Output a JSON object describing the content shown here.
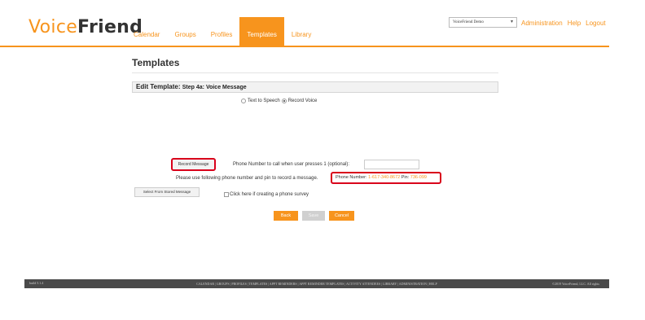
{
  "brand": {
    "part1": "Voice",
    "part2": "Friend"
  },
  "nav": {
    "items": [
      {
        "label": "Calendar"
      },
      {
        "label": "Groups"
      },
      {
        "label": "Profiles"
      },
      {
        "label": "Templates",
        "active": true
      },
      {
        "label": "Library"
      }
    ]
  },
  "account": {
    "selected": "VoiceFriend Demo"
  },
  "header_links": {
    "administration": "Administration",
    "help": "Help",
    "logout": "Logout"
  },
  "page": {
    "title": "Templates"
  },
  "section": {
    "title": "Edit Template:",
    "subtitle": "Step 4a: Voice Message"
  },
  "message_type": {
    "options": [
      {
        "label": "Text to Speech",
        "checked": false
      },
      {
        "label": "Record Voice",
        "checked": true
      }
    ]
  },
  "record": {
    "button_label": "Record Message",
    "callnum_label": "Phone Number to call when user presses 1 (optional):",
    "callnum_value": "",
    "instruction": "Please use following phone number and pin to record a message.",
    "phone_label": "Phone Number:",
    "phone_value": "1-617-340-8672",
    "pin_label": "Pin:",
    "pin_value": "736-099"
  },
  "stored": {
    "button_label": "Select From Stored Message"
  },
  "survey": {
    "label": "Click here if creating a phone survey",
    "checked": false
  },
  "actions": {
    "back": "Back",
    "save": "Save",
    "cancel": "Cancel"
  },
  "footer": {
    "build": "build 5.1.4",
    "links": "CALENDAR | GROUPS | PROFILES | TEMPLATES | APPT REMINDERS | APPT REMINDER TEMPLATES | ACTIVITY ATTENDEES | LIBRARY | ADMINISTRATION | HELP",
    "copyright": "©2019 VoiceFriend, LLC. All rights"
  },
  "colors": {
    "accent": "#f7941d",
    "highlight": "#d9001b",
    "footer_bg": "#4a4a4a"
  }
}
